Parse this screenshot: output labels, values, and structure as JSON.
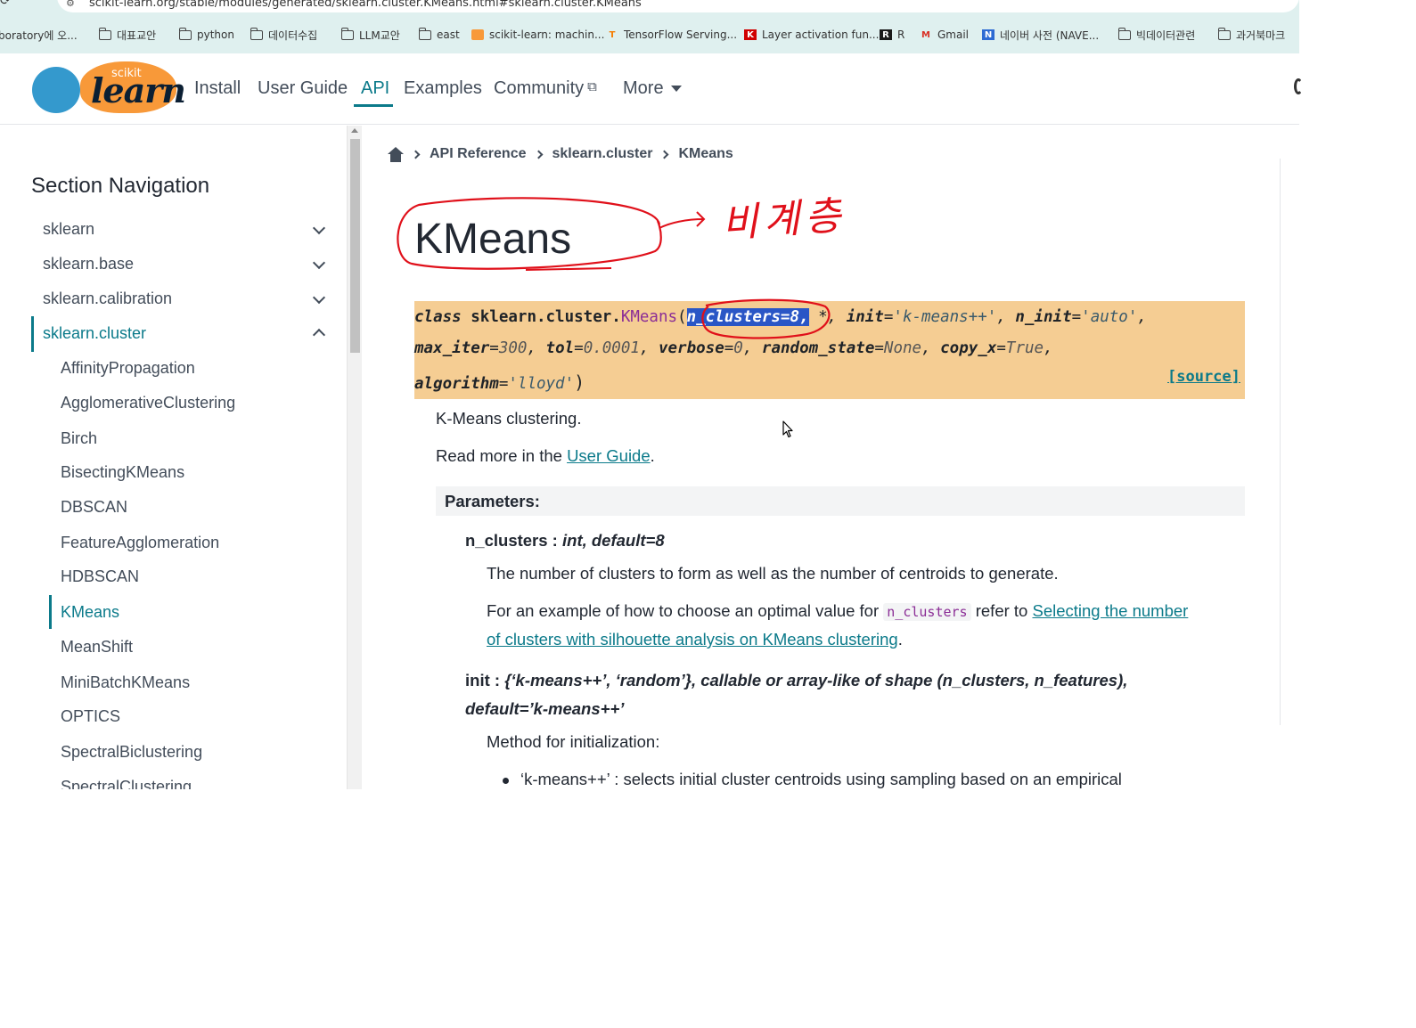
{
  "browser": {
    "url": "scikit-learn.org/stable/modules/generated/sklearn.cluster.KMeans.html#sklearn.cluster.KMeans",
    "bookmarks": [
      {
        "label": "boratory에 오...",
        "icon": "page-icon"
      },
      {
        "label": "대표교안",
        "icon": "folder-icon"
      },
      {
        "label": "python",
        "icon": "folder-icon"
      },
      {
        "label": "데이터수집",
        "icon": "folder-icon"
      },
      {
        "label": "LLM교안",
        "icon": "folder-icon"
      },
      {
        "label": "east",
        "icon": "folder-icon"
      },
      {
        "label": "scikit-learn: machin...",
        "icon": "scikit-icon"
      },
      {
        "label": "TensorFlow Serving...",
        "icon": "tensorflow-icon"
      },
      {
        "label": "Layer activation fun...",
        "icon": "keras-icon"
      },
      {
        "label": "R",
        "icon": "r-icon"
      },
      {
        "label": "Gmail",
        "icon": "gmail-icon"
      },
      {
        "label": "네이버 사전 (NAVE...",
        "icon": "naver-dict-icon"
      },
      {
        "label": "빅데이터관련",
        "icon": "folder-icon"
      },
      {
        "label": "과거북마크",
        "icon": "folder-icon"
      }
    ]
  },
  "header": {
    "logo_small": "scikit",
    "logo_big": "learn",
    "nav": [
      "Install",
      "User Guide",
      "API",
      "Examples",
      "Community",
      "More"
    ],
    "active_nav": "API"
  },
  "sidebar": {
    "title": "Section Navigation",
    "modules": [
      "sklearn",
      "sklearn.base",
      "sklearn.calibration",
      "sklearn.cluster"
    ],
    "active_module": "sklearn.cluster",
    "sub_items": [
      "AffinityPropagation",
      "AgglomerativeClustering",
      "Birch",
      "BisectingKMeans",
      "DBSCAN",
      "FeatureAgglomeration",
      "HDBSCAN",
      "KMeans",
      "MeanShift",
      "MiniBatchKMeans",
      "OPTICS",
      "SpectralBiclustering",
      "SpectralClustering"
    ],
    "active_sub": "KMeans"
  },
  "main": {
    "breadcrumb": [
      "API Reference",
      "sklearn.cluster",
      "KMeans"
    ],
    "title": "KMeans",
    "signature": {
      "kw_class": "class",
      "module": "sklearn.cluster.",
      "name": "KMeans",
      "open_paren": "(",
      "highlighted": "n_clusters=8,",
      "line1_rest": " *, ",
      "init_name": "init",
      "init_val": "'k-means++'",
      "n_init_name": "n_init",
      "n_init_val": "'auto'",
      "max_iter_name": "max_iter",
      "max_iter_val": "300",
      "tol_name": "tol",
      "tol_val": "0.0001",
      "verbose_name": "verbose",
      "verbose_val": "0",
      "random_state_name": "random_state",
      "random_state_val": "None",
      "copy_x_name": "copy_x",
      "copy_x_val": "True",
      "algorithm_name": "algorithm",
      "algorithm_val": "'lloyd'",
      "close_paren": ")",
      "source": "[source]"
    },
    "summary": "K-Means clustering.",
    "read_more_prefix": "Read more in the ",
    "read_more_link": "User Guide",
    "read_more_suffix": ".",
    "params_heading": "Parameters:",
    "param1": {
      "name": "n_clusters",
      "sep": " : ",
      "type": "int, default=8",
      "desc": "The number of clusters to form as well as the number of centroids to generate.",
      "example_prefix": "For an example of how to choose an optimal value for ",
      "example_code": "n_clusters",
      "example_mid": " refer to ",
      "example_link1": "Selecting the number",
      "example_link2": "of clusters with silhouette analysis on KMeans clustering",
      "example_suffix": "."
    },
    "param2": {
      "name": "init",
      "sep": " : ",
      "type_line1": "{‘k-means++’, ‘random’}, callable or array-like of shape (n_clusters, n_features),",
      "type_line2": "default=’k-means++’",
      "desc": "Method for initialization:",
      "bullet1": "‘k-means++’ : selects initial cluster centroids using sampling based on an empirical"
    }
  },
  "annotation": {
    "handwritten_text": "비계층",
    "color": "#e0101a"
  },
  "colors": {
    "accent": "#0b7a8a",
    "signature_bg": "#f5cd93",
    "chrome_bg": "#dff0ef",
    "logo_orange": "#f89939",
    "logo_blue": "#3499cd"
  }
}
